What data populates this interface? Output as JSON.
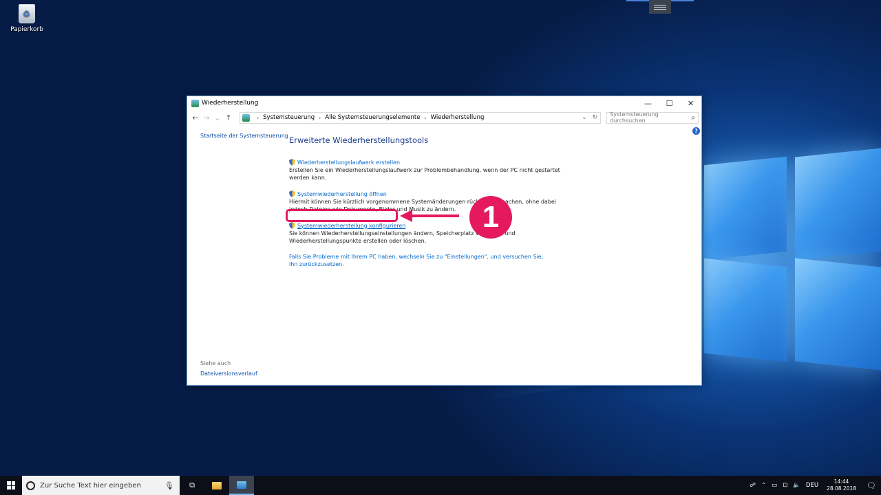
{
  "desktop": {
    "recycle_bin_label": "Papierkorb"
  },
  "window": {
    "title": "Wiederherstellung",
    "controls": {
      "minimize": "—",
      "maximize": "☐",
      "close": "✕"
    },
    "nav": {
      "back": "←",
      "forward": "→",
      "recent": "⌄",
      "up": "↑"
    },
    "breadcrumb": [
      "Systemsteuerung",
      "Alle Systemsteuerungselemente",
      "Wiederherstellung"
    ],
    "breadcrumb_sep": "›",
    "address_dropdown": "⌄",
    "refresh": "↻",
    "search_placeholder": "Systemsteuerung durchsuchen",
    "help": "?",
    "left_link": "Startseite der Systemsteuerung",
    "see_also": "Siehe auch",
    "see_also_link": "Dateiversionsverlauf",
    "heading": "Erweiterte Wiederherstellungstools",
    "items": [
      {
        "link": "Wiederherstellungslaufwerk erstellen",
        "desc": "Erstellen Sie ein Wiederherstellungslaufwerk zur Problembehandlung, wenn der PC nicht gestartet werden kann."
      },
      {
        "link": "Systemwiederherstellung öffnen",
        "desc": "Hiermit können Sie kürzlich vorgenommene Systemänderungen rückgängig machen, ohne dabei jedoch Dateien wie Dokumente, Bilder und Musik zu ändern."
      },
      {
        "link": "Systemwiederherstellung konfigurieren",
        "desc": "Sie können Wiederherstellungseinstellungen ändern, Speicherplatz verwalten und Wiederherstellungspunkte erstellen oder löschen."
      }
    ],
    "reset_hint": "Falls Sie Probleme mit Ihrem PC haben, wechseln Sie zu \"Einstellungen\", und versuchen Sie, ihn zurückzusetzen."
  },
  "annotation": {
    "step_number": "1",
    "color": "#e5195e"
  },
  "taskbar": {
    "search_placeholder": "Zur Suche Text hier eingeben",
    "mic": "🎙",
    "task_view": "⧉",
    "tray": {
      "people": "☍",
      "chevron": "⌃",
      "battery": "▭",
      "network": "⊡",
      "volume": "🔈",
      "language": "DEU"
    },
    "time": "14:44",
    "date": "28.08.2018",
    "notification": "🗨"
  }
}
